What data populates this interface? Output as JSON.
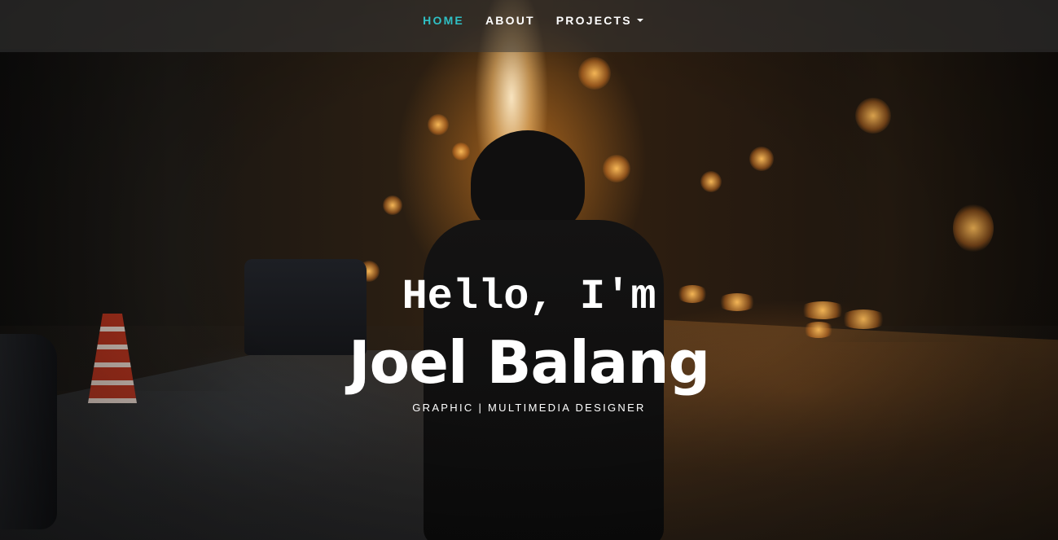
{
  "nav": {
    "items": [
      {
        "label": "HOME",
        "active": true
      },
      {
        "label": "ABOUT",
        "active": false
      },
      {
        "label": "PROJECTS",
        "active": false,
        "dropdown": true
      }
    ],
    "active_color": "#2fc0c5",
    "dropdown_icon": "caret-down-icon"
  },
  "hero": {
    "greeting": "Hello, I'm",
    "name": "Joel Balang",
    "role": "GRAPHIC | MULTIMEDIA DESIGNER"
  }
}
